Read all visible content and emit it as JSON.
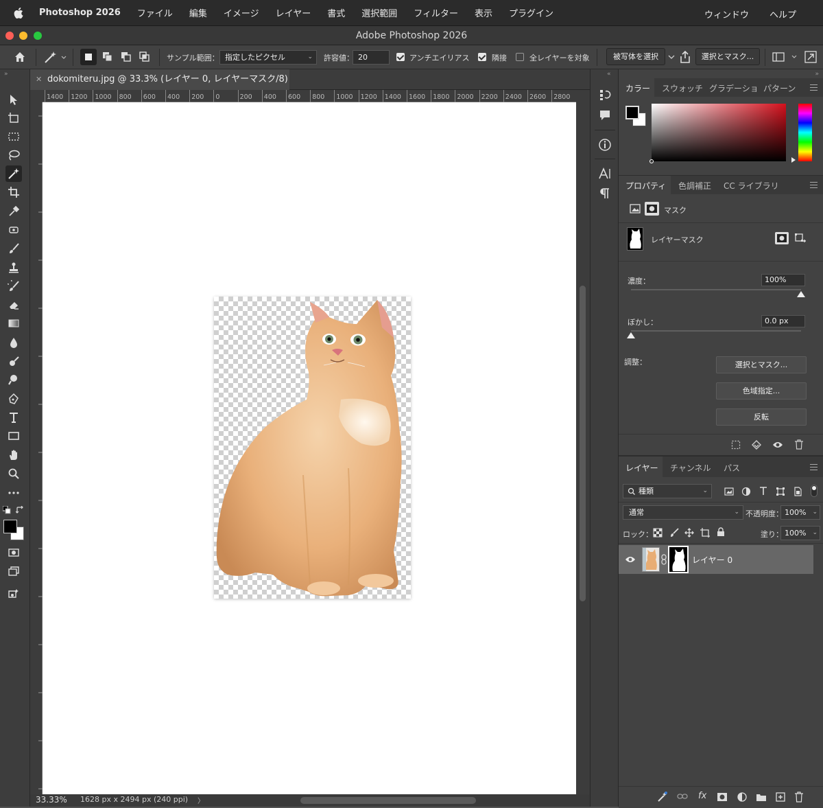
{
  "menubar": {
    "app": "Photoshop 2026",
    "items": [
      "ファイル",
      "編集",
      "イメージ",
      "レイヤー",
      "書式",
      "選択範囲",
      "フィルター",
      "表示",
      "プラグイン"
    ],
    "right_items": [
      "ウィンドウ",
      "ヘルプ"
    ]
  },
  "window": {
    "title": "Adobe Photoshop 2026"
  },
  "options_bar": {
    "sample_label": "サンプル範囲：",
    "sample_value": "指定したピクセル",
    "tolerance_label": "許容値：",
    "tolerance_value": "20",
    "antialias_label": "アンチエイリアス",
    "antialias_checked": true,
    "contiguous_label": "隣接",
    "contiguous_checked": true,
    "all_layers_label": "全レイヤーを対象",
    "all_layers_checked": false,
    "select_subject_label": "被写体を選択",
    "select_mask_label": "選択とマスク..."
  },
  "document": {
    "tab_title": "dokomiteru.jpg @ 33.3% (レイヤー 0, レイヤーマスク/8) *",
    "ruler_top_labels": [
      "1400",
      "1200",
      "1000",
      "800",
      "600",
      "400",
      "200",
      "0",
      "200",
      "400",
      "600",
      "800",
      "1000",
      "1200",
      "1400",
      "1600",
      "1800",
      "2000",
      "2200",
      "2400",
      "2600",
      "2800"
    ],
    "zoom": "33.33%",
    "info": "1628 px x 2494 px (240 ppi)",
    "status_arrow": "〉"
  },
  "color_panel": {
    "tabs": [
      "カラー",
      "スウォッチ",
      "グラデーション",
      "パターン"
    ],
    "foreground": "#000000",
    "background": "#ffffff",
    "hue_color": "#d4101c"
  },
  "properties_panel": {
    "tabs": [
      "プロパティ",
      "色調補正",
      "CC ライブラリ"
    ],
    "mask_label": "マスク",
    "layer_mask_label": "レイヤーマスク",
    "density_label": "濃度：",
    "density_value": "100%",
    "density_fraction": 1.0,
    "feather_label": "ぼかし：",
    "feather_value": "0.0 px",
    "feather_fraction": 0.0,
    "adjust_label": "調整：",
    "btn_select_mask": "選択とマスク...",
    "btn_color_range": "色域指定...",
    "btn_invert": "反転"
  },
  "layers_panel": {
    "tabs": [
      "レイヤー",
      "チャンネル",
      "パス"
    ],
    "filter_value": "種類",
    "blend_mode": "通常",
    "opacity_label": "不透明度：",
    "opacity_value": "100%",
    "lock_label": "ロック：",
    "fill_label": "塗り：",
    "fill_value": "100%",
    "layers": [
      {
        "name": "レイヤー 0",
        "visible": true
      }
    ]
  }
}
